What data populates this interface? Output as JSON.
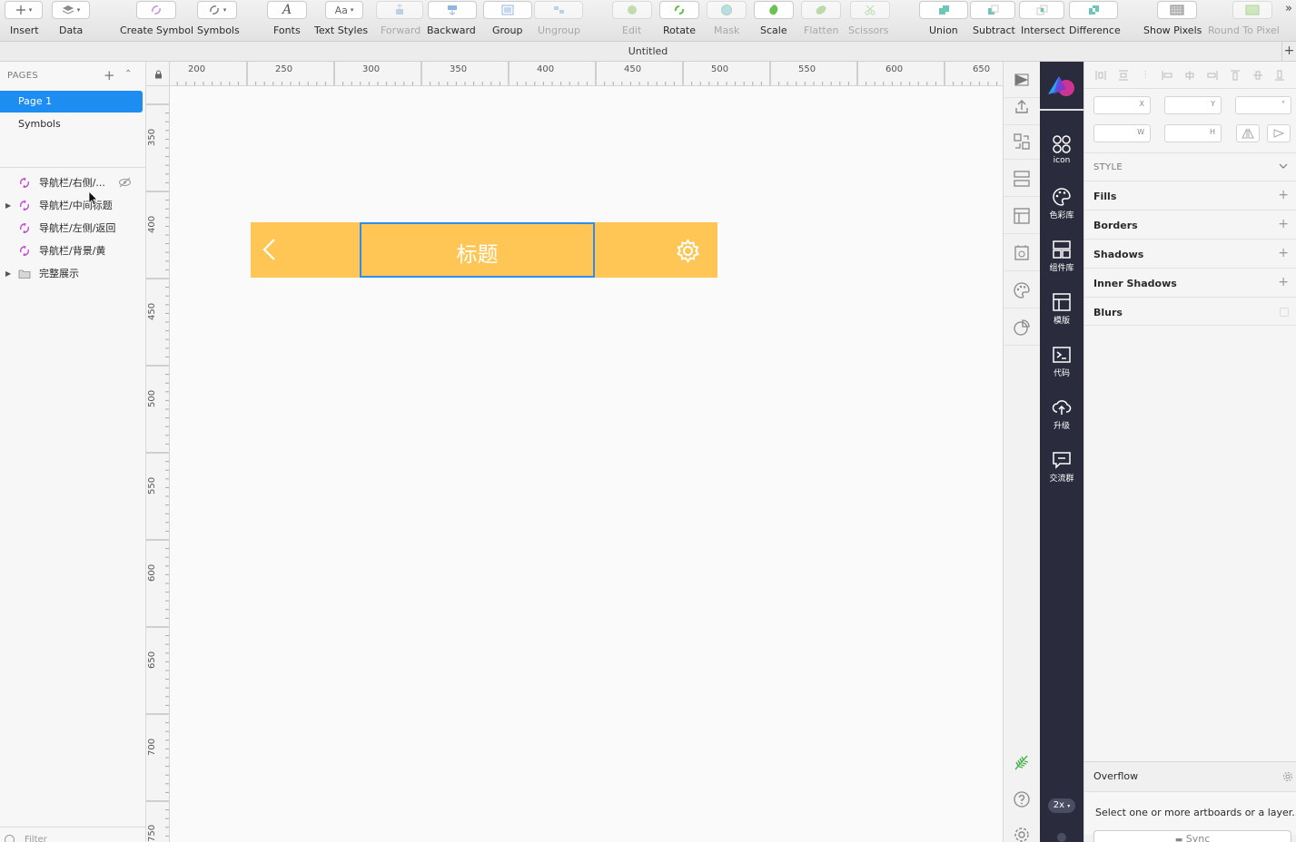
{
  "window": {
    "title": "Untitled"
  },
  "toolbar": {
    "insert": "Insert",
    "data": "Data",
    "create_symbol": "Create Symbol",
    "symbols": "Symbols",
    "fonts": "Fonts",
    "text_styles": "Text Styles",
    "text_styles_icon": "Aa",
    "forward": "Forward",
    "backward": "Backward",
    "group": "Group",
    "ungroup": "Ungroup",
    "edit": "Edit",
    "rotate": "Rotate",
    "mask": "Mask",
    "scale": "Scale",
    "flatten": "Flatten",
    "scissors": "Scissors",
    "union": "Union",
    "subtract": "Subtract",
    "intersect": "Intersect",
    "difference": "Difference",
    "show_pixels": "Show Pixels",
    "round_to_pixel": "Round To Pixel"
  },
  "pages": {
    "header": "PAGES",
    "items": [
      {
        "label": "Page 1",
        "active": true
      },
      {
        "label": "Symbols",
        "active": false
      }
    ]
  },
  "layers": [
    {
      "name": "导航栏/右侧/...",
      "type": "symbol",
      "hidden": true
    },
    {
      "name": "导航栏/中间标题",
      "type": "symbol",
      "expandable": true
    },
    {
      "name": "导航栏/左侧/返回",
      "type": "symbol"
    },
    {
      "name": "导航栏/背景/黄",
      "type": "symbol"
    },
    {
      "name": "完整展示",
      "type": "folder",
      "expandable": true
    }
  ],
  "filter": {
    "placeholder": "Filter"
  },
  "rulers": {
    "horizontal": [
      "200",
      "250",
      "300",
      "350",
      "400",
      "450",
      "500",
      "550",
      "600",
      "650"
    ],
    "vertical": [
      "350",
      "400",
      "450",
      "500",
      "550",
      "600",
      "650",
      "700",
      "750"
    ]
  },
  "canvas": {
    "navbar_title": "标题",
    "navbar_color": "#ffc655",
    "selection_color": "#2f8cf0"
  },
  "plugin_panel": {
    "items": [
      "icon",
      "色彩库",
      "组件库",
      "模版",
      "代码",
      "升级",
      "交流群"
    ],
    "zoom_badge": "2x"
  },
  "inspector": {
    "x_label": "X",
    "y_label": "Y",
    "rotation_label": "°",
    "w_label": "W",
    "h_label": "H",
    "style_header": "STYLE",
    "properties": [
      "Fills",
      "Borders",
      "Shadows",
      "Inner Shadows",
      "Blurs"
    ],
    "overflow_title": "Overflow",
    "overflow_message": "Select one or more artboards or a layer...",
    "sync_button": "Sync"
  },
  "colors": {
    "accent": "#1d8df1",
    "plugin_bg": "#2a2c3d",
    "symbol_icon": "#c23fd2"
  }
}
